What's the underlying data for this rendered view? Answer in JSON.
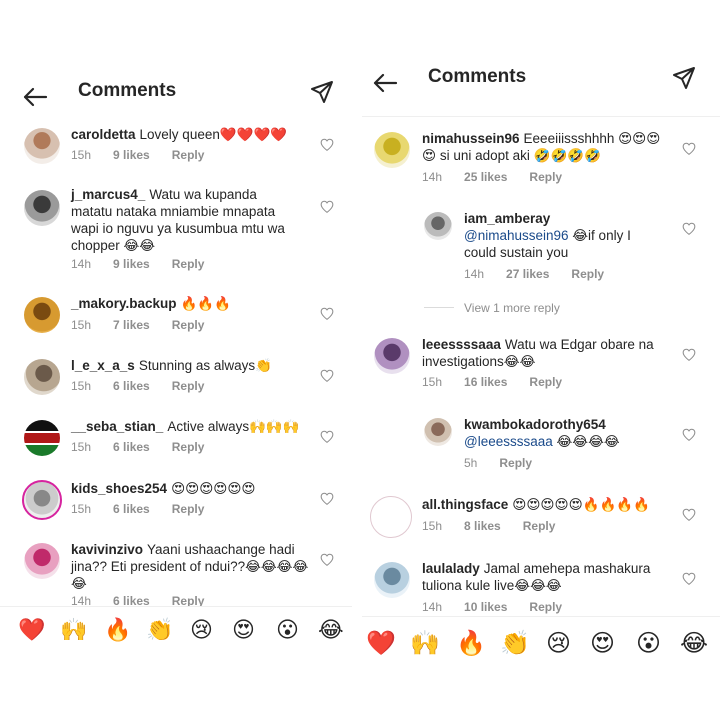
{
  "left": {
    "title": "Comments",
    "comments": [
      {
        "user": "caroldetta",
        "text": "Lovely queen❤️❤️❤️❤️",
        "time": "15h",
        "likes": "9 likes",
        "reply": "Reply"
      },
      {
        "user": "j_marcus4_",
        "text": "Watu wa kupanda matatu nataka mniambie mnapata wapi io nguvu ya kusumbua mtu wa chopper 😂😂",
        "time": "14h",
        "likes": "9 likes",
        "reply": "Reply"
      },
      {
        "user": "_makory.backup",
        "text": "🔥🔥🔥",
        "time": "15h",
        "likes": "7 likes",
        "reply": "Reply"
      },
      {
        "user": "l_e_x_a_s",
        "text": "Stunning as always👏",
        "time": "15h",
        "likes": "6 likes",
        "reply": "Reply"
      },
      {
        "user": "__seba_stian_",
        "text": "Active always🙌🙌🙌",
        "time": "15h",
        "likes": "6 likes",
        "reply": "Reply"
      },
      {
        "user": "kids_shoes254",
        "text": "😍😍😍😍😍😍",
        "time": "15h",
        "likes": "6 likes",
        "reply": "Reply"
      },
      {
        "user": "kavivinzivo",
        "text": "Yaani ushaachange hadi jina?? Eti president of ndui??😂😂😂😂😂",
        "time": "14h",
        "likes": "6 likes",
        "reply": "Reply"
      }
    ],
    "reactions": [
      "❤️",
      "🙌",
      "🔥",
      "👏",
      "😢",
      "😍",
      "😮",
      "😂"
    ]
  },
  "right": {
    "title": "Comments",
    "comments": [
      {
        "user": "nimahussein96",
        "text": "Eeeeiiissshhhh 😍😍😍😍 si uni adopt aki 🤣🤣🤣🤣",
        "time": "14h",
        "likes": "25 likes",
        "reply": "Reply"
      },
      {
        "user": "iam_amberay",
        "mention": "@nimahussein96",
        "text": "😂if only I could sustain you",
        "time": "14h",
        "likes": "27 likes",
        "reply": "Reply"
      },
      {
        "user": "leeessssaaa",
        "text": "Watu wa Edgar obare na investigations😂😂",
        "time": "15h",
        "likes": "16 likes",
        "reply": "Reply"
      },
      {
        "user": "kwambokadorothy654",
        "mention": "@leeessssaaa",
        "text": "😂😂😂😂",
        "time": "5h",
        "likes": "",
        "reply": "Reply"
      },
      {
        "user": "all.thingsface",
        "text": "😍😍😍😍😍🔥🔥🔥🔥",
        "time": "15h",
        "likes": "8 likes",
        "reply": "Reply"
      },
      {
        "user": "laulalady",
        "text": "Jamal amehepa mashakura tuliona kule live😂😂😂",
        "time": "14h",
        "likes": "10 likes",
        "reply": "Reply"
      }
    ],
    "view_more": "View 1 more reply",
    "reactions": [
      "❤️",
      "🙌",
      "🔥",
      "👏",
      "😢",
      "😍",
      "😮",
      "😂"
    ]
  },
  "colors": {
    "text": "#262626",
    "meta": "#8e8e8e",
    "mention": "#1a4a8a",
    "heart": "#c7c7c7"
  }
}
